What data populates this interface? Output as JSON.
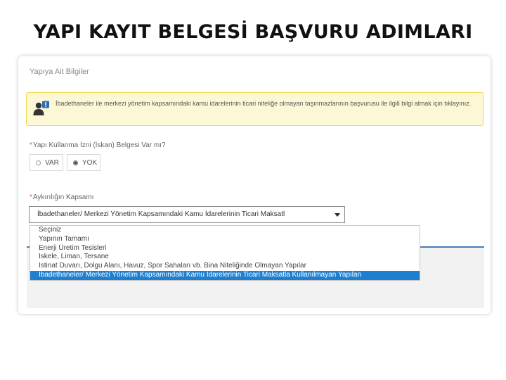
{
  "slide_title": "YAPI KAYIT BELGESİ BAŞVURU ADIMLARI",
  "section_title": "Yapıya Ait Bilgiler",
  "alert": {
    "icon": "user-info-icon",
    "text": "İbadethaneler ile merkezi yönetim kapsamındaki kamu idarelerinin ticari niteliğe olmayan taşınmazlarının başvurusu ile ilgili bilgi almak için tıklayınız."
  },
  "question_1": {
    "label": "Yapı Kullanma İzni (İskan) Belgesi Var mı?",
    "options": [
      "VAR",
      "YOK"
    ],
    "selected": "YOK"
  },
  "question_2": {
    "label": "Aykırılığın Kapsamı",
    "selected_value": "İbadethaneler/ Merkezi Yönetim Kapsamındaki Kamu İdarelerinin Ticari Maksatl",
    "options": [
      "Seçiniz",
      "Yapının Tamamı",
      "Enerji Üretim Tesisleri",
      "İskele, Liman, Tersane",
      "İstinat Duvarı, Dolgu Alanı, Havuz, Spor Sahaları vb. Bina Niteliğinde Olmayan Yapılar",
      "İbadethaneler/ Merkezi Yönetim Kapsamındaki Kamu İdarelerinin Ticari Maksatla Kullanılmayan Yapıları"
    ],
    "highlighted_index": 5
  },
  "colors": {
    "highlight": "#1e7fd1",
    "alert_bg": "#fcf8d6",
    "accent_line": "#4a7ab8"
  }
}
